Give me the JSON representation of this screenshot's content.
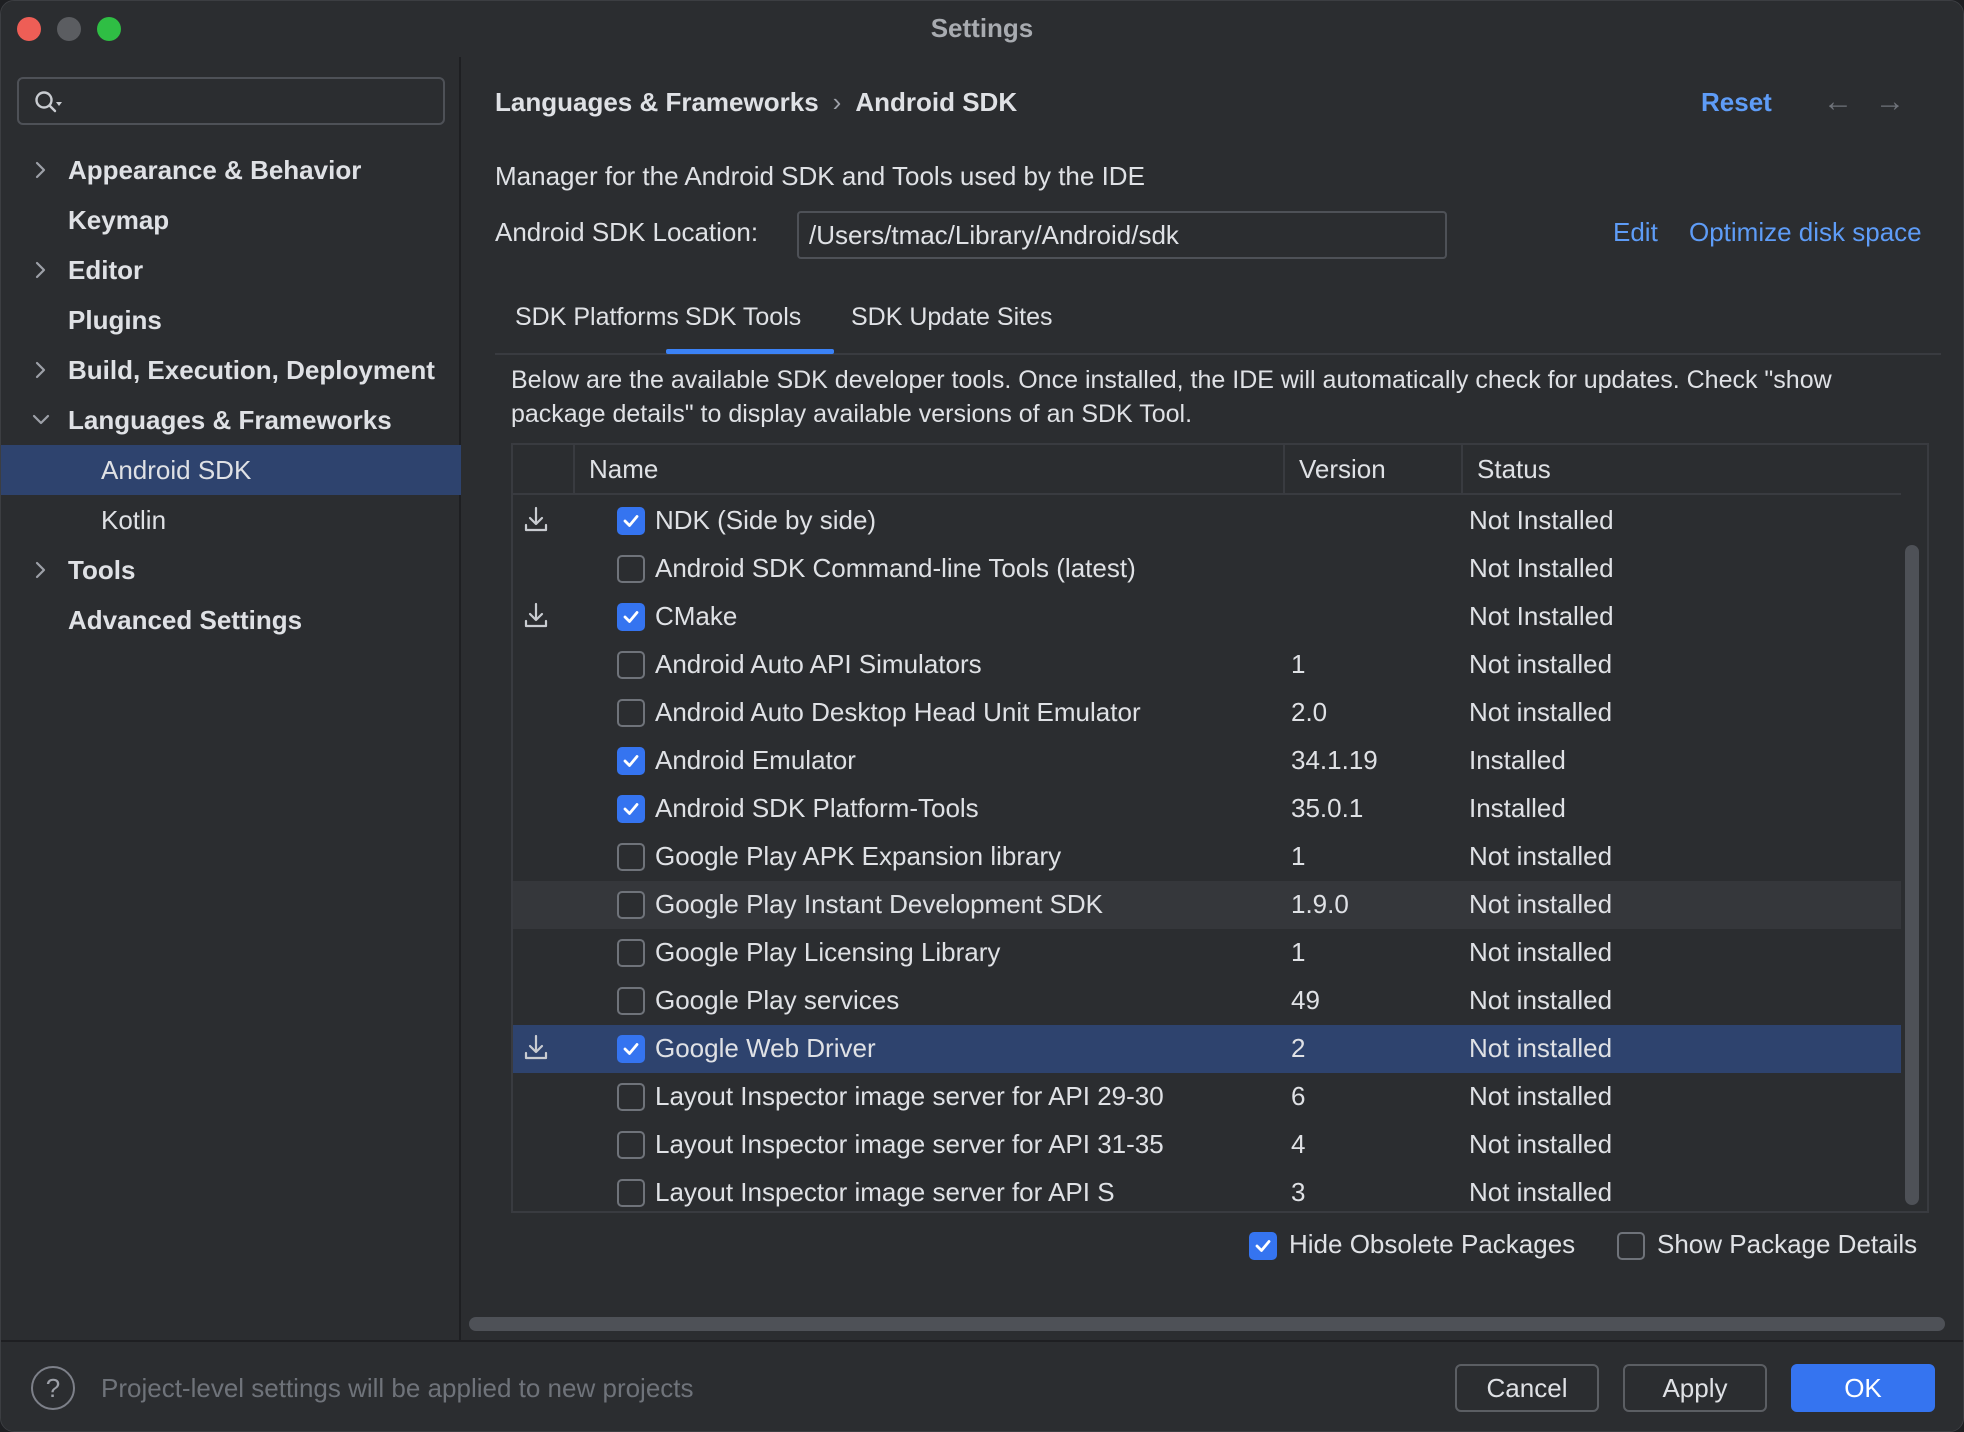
{
  "window": {
    "title": "Settings"
  },
  "sidebar": {
    "search_placeholder": "",
    "items": [
      {
        "label": "Appearance & Behavior",
        "expandable": true,
        "expanded": false
      },
      {
        "label": "Keymap",
        "expandable": false
      },
      {
        "label": "Editor",
        "expandable": true,
        "expanded": false
      },
      {
        "label": "Plugins",
        "expandable": false
      },
      {
        "label": "Build, Execution, Deployment",
        "expandable": true,
        "expanded": false
      },
      {
        "label": "Languages & Frameworks",
        "expandable": true,
        "expanded": true
      },
      {
        "label": "Android SDK",
        "sub": true,
        "selected": true
      },
      {
        "label": "Kotlin",
        "sub": true
      },
      {
        "label": "Tools",
        "expandable": true,
        "expanded": false
      },
      {
        "label": "Advanced Settings",
        "expandable": false
      }
    ]
  },
  "header": {
    "breadcrumb_parent": "Languages & Frameworks",
    "breadcrumb_sep": "›",
    "breadcrumb_current": "Android SDK",
    "reset": "Reset",
    "back_arrow": "←",
    "forward_arrow": "→"
  },
  "sdk": {
    "description": "Manager for the Android SDK and Tools used by the IDE",
    "location_label": "Android SDK Location:",
    "location_value": "/Users/tmac/Library/Android/sdk",
    "edit": "Edit",
    "optimize": "Optimize disk space"
  },
  "tabs": [
    {
      "label": "SDK Platforms"
    },
    {
      "label": "SDK Tools",
      "active": true
    },
    {
      "label": "SDK Update Sites"
    }
  ],
  "tools_description": "Below are the available SDK developer tools. Once installed, the IDE will automatically check for updates. Check \"show package details\" to display available versions of an SDK Tool.",
  "table": {
    "columns": [
      "Name",
      "Version",
      "Status"
    ],
    "rows": [
      {
        "download": true,
        "checked": true,
        "name": "NDK (Side by side)",
        "version": "",
        "status": "Not Installed"
      },
      {
        "download": false,
        "checked": false,
        "name": "Android SDK Command-line Tools (latest)",
        "version": "",
        "status": "Not Installed"
      },
      {
        "download": true,
        "checked": true,
        "name": "CMake",
        "version": "",
        "status": "Not Installed"
      },
      {
        "download": false,
        "checked": false,
        "name": "Android Auto API Simulators",
        "version": "1",
        "status": "Not installed"
      },
      {
        "download": false,
        "checked": false,
        "name": "Android Auto Desktop Head Unit Emulator",
        "version": "2.0",
        "status": "Not installed"
      },
      {
        "download": false,
        "checked": true,
        "name": "Android Emulator",
        "version": "34.1.19",
        "status": "Installed"
      },
      {
        "download": false,
        "checked": true,
        "name": "Android SDK Platform-Tools",
        "version": "35.0.1",
        "status": "Installed"
      },
      {
        "download": false,
        "checked": false,
        "name": "Google Play APK Expansion library",
        "version": "1",
        "status": "Not installed"
      },
      {
        "download": false,
        "checked": false,
        "name": "Google Play Instant Development SDK",
        "version": "1.9.0",
        "status": "Not installed",
        "hover": true
      },
      {
        "download": false,
        "checked": false,
        "name": "Google Play Licensing Library",
        "version": "1",
        "status": "Not installed"
      },
      {
        "download": false,
        "checked": false,
        "name": "Google Play services",
        "version": "49",
        "status": "Not installed"
      },
      {
        "download": true,
        "checked": true,
        "name": "Google Web Driver",
        "version": "2",
        "status": "Not installed",
        "selected": true
      },
      {
        "download": false,
        "checked": false,
        "name": "Layout Inspector image server for API 29-30",
        "version": "6",
        "status": "Not installed"
      },
      {
        "download": false,
        "checked": false,
        "name": "Layout Inspector image server for API 31-35",
        "version": "4",
        "status": "Not installed"
      },
      {
        "download": false,
        "checked": false,
        "name": "Layout Inspector image server for API S",
        "version": "3",
        "status": "Not installed"
      }
    ]
  },
  "options": {
    "hide_obsolete": {
      "label": "Hide Obsolete Packages",
      "checked": true
    },
    "show_details": {
      "label": "Show Package Details",
      "checked": false
    }
  },
  "footer": {
    "help": "?",
    "note": "Project-level settings will be applied to new projects",
    "cancel": "Cancel",
    "apply": "Apply",
    "ok": "OK"
  },
  "colors": {
    "accent": "#3574f0",
    "link": "#5e9cf7",
    "selection": "#2e436e",
    "background": "#2b2d30"
  }
}
